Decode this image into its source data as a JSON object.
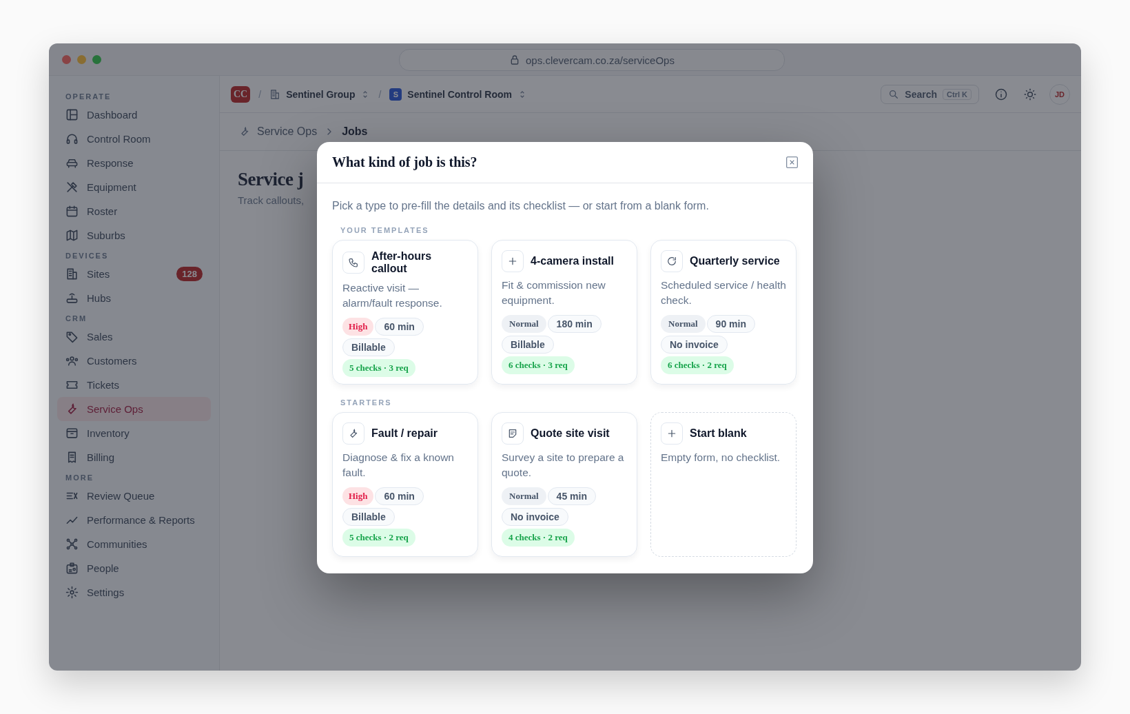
{
  "window": {
    "url": "ops.clevercam.co.za/serviceOps"
  },
  "topbar": {
    "logo": "CC",
    "separator_1": "/",
    "org": "Sentinel Group",
    "separator_2": "/",
    "site_badge": "S",
    "site": "Sentinel Control Room",
    "search": {
      "label": "Search",
      "shortcut": "Ctrl K"
    },
    "avatar": "JD"
  },
  "breadcrumb": [
    {
      "text": "Service Ops",
      "current": false
    },
    {
      "text": "Jobs",
      "current": true
    }
  ],
  "page": {
    "title": "Service j",
    "subtitle": "Track callouts,"
  },
  "sidebar": {
    "sections": [
      {
        "label": "OPERATE",
        "items": [
          {
            "label": "Dashboard",
            "selected": false
          },
          {
            "label": "Control Room",
            "selected": false
          },
          {
            "label": "Response",
            "selected": false
          },
          {
            "label": "Equipment",
            "selected": false
          },
          {
            "label": "Roster",
            "selected": false
          },
          {
            "label": "Suburbs",
            "selected": false
          }
        ]
      },
      {
        "label": "DEVICES",
        "items": [
          {
            "label": "Sites",
            "selected": false,
            "badge": "128"
          },
          {
            "label": "Hubs",
            "selected": false
          }
        ]
      },
      {
        "label": "CRM",
        "items": [
          {
            "label": "Sales",
            "selected": false
          },
          {
            "label": "Customers",
            "selected": false
          },
          {
            "label": "Tickets",
            "selected": false
          },
          {
            "label": "Service Ops",
            "selected": true
          },
          {
            "label": "Inventory",
            "selected": false
          },
          {
            "label": "Billing",
            "selected": false
          }
        ]
      },
      {
        "label": "MORE",
        "items": [
          {
            "label": "Review Queue",
            "selected": false
          },
          {
            "label": "Performance & Reports",
            "selected": false
          },
          {
            "label": "Communities",
            "selected": false
          },
          {
            "label": "People",
            "selected": false
          },
          {
            "label": "Settings",
            "selected": false
          }
        ]
      }
    ]
  },
  "modal": {
    "title": "What kind of job is this?",
    "intro": "Pick a type to pre-fill the details and its checklist — or start from a blank form.",
    "groups": [
      {
        "label": "YOUR TEMPLATES",
        "cards": [
          {
            "kind": "template",
            "title": "After-hours callout",
            "description": "Reactive visit — alarm/fault response.",
            "tags": [
              {
                "kind": "high",
                "text": "High"
              },
              {
                "kind": "plain",
                "text": "60 min"
              },
              {
                "kind": "plain",
                "text": "Billable"
              },
              {
                "kind": "checks",
                "text": "5 checks · 3 req"
              }
            ]
          },
          {
            "kind": "template",
            "title": "4-camera install",
            "description": "Fit & commission new equipment.",
            "tags": [
              {
                "kind": "normal",
                "text": "Normal"
              },
              {
                "kind": "plain",
                "text": "180 min"
              },
              {
                "kind": "plain",
                "text": "Billable"
              },
              {
                "kind": "checks",
                "text": "6 checks · 3 req"
              }
            ]
          },
          {
            "kind": "template",
            "title": "Quarterly service",
            "description": "Scheduled service / health check.",
            "tags": [
              {
                "kind": "normal",
                "text": "Normal"
              },
              {
                "kind": "plain",
                "text": "90 min"
              },
              {
                "kind": "plain",
                "text": "No invoice"
              },
              {
                "kind": "checks",
                "text": "6 checks · 2 req"
              }
            ]
          }
        ]
      },
      {
        "label": "STARTERS",
        "cards": [
          {
            "kind": "template",
            "title": "Fault / repair",
            "description": "Diagnose & fix a known fault.",
            "tags": [
              {
                "kind": "high",
                "text": "High"
              },
              {
                "kind": "plain",
                "text": "60 min"
              },
              {
                "kind": "plain",
                "text": "Billable"
              },
              {
                "kind": "checks",
                "text": "5 checks · 2 req"
              }
            ]
          },
          {
            "kind": "template",
            "title": "Quote site visit",
            "description": "Survey a site to prepare a quote.",
            "tags": [
              {
                "kind": "normal",
                "text": "Normal"
              },
              {
                "kind": "plain",
                "text": "45 min"
              },
              {
                "kind": "plain",
                "text": "No invoice"
              },
              {
                "kind": "checks",
                "text": "4 checks · 2 req"
              }
            ]
          },
          {
            "kind": "blank",
            "title": "Start blank",
            "description": "Empty form, no checklist."
          }
        ]
      }
    ]
  }
}
